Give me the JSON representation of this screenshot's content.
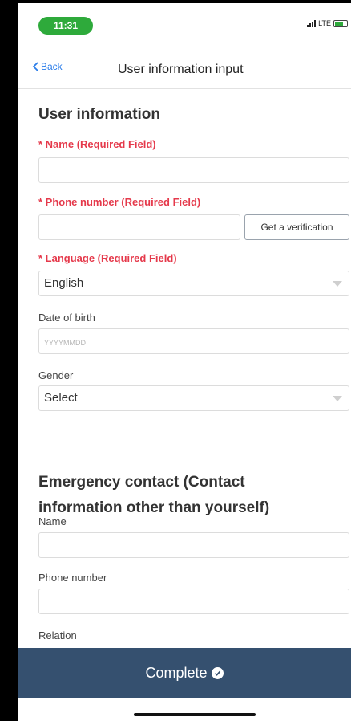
{
  "status": {
    "time": "11:31",
    "network": "LTE"
  },
  "nav": {
    "back_label": "Back",
    "title": "User information input"
  },
  "user_info": {
    "section_title": "User information",
    "name_label": "* Name (Required Field)",
    "name_value": "",
    "phone_label": "* Phone number (Required Field)",
    "phone_value": "",
    "verify_button": "Get a verification",
    "language_label": "* Language (Required Field)",
    "language_value": "English",
    "dob_label": "Date of birth",
    "dob_placeholder": "YYYYMMDD",
    "gender_label": "Gender",
    "gender_value": "Select"
  },
  "emergency": {
    "section_title_line1": "Emergency contact (Contact",
    "section_title_line2": "information other than yourself)",
    "name_label": "Name",
    "phone_label": "Phone number",
    "relation_label": "Relation"
  },
  "footer": {
    "complete_label": "Complete"
  },
  "colors": {
    "required": "#e5394b",
    "accent": "#2b7de9",
    "footer_bg": "#35506f",
    "time_pill": "#2eaa3b"
  }
}
